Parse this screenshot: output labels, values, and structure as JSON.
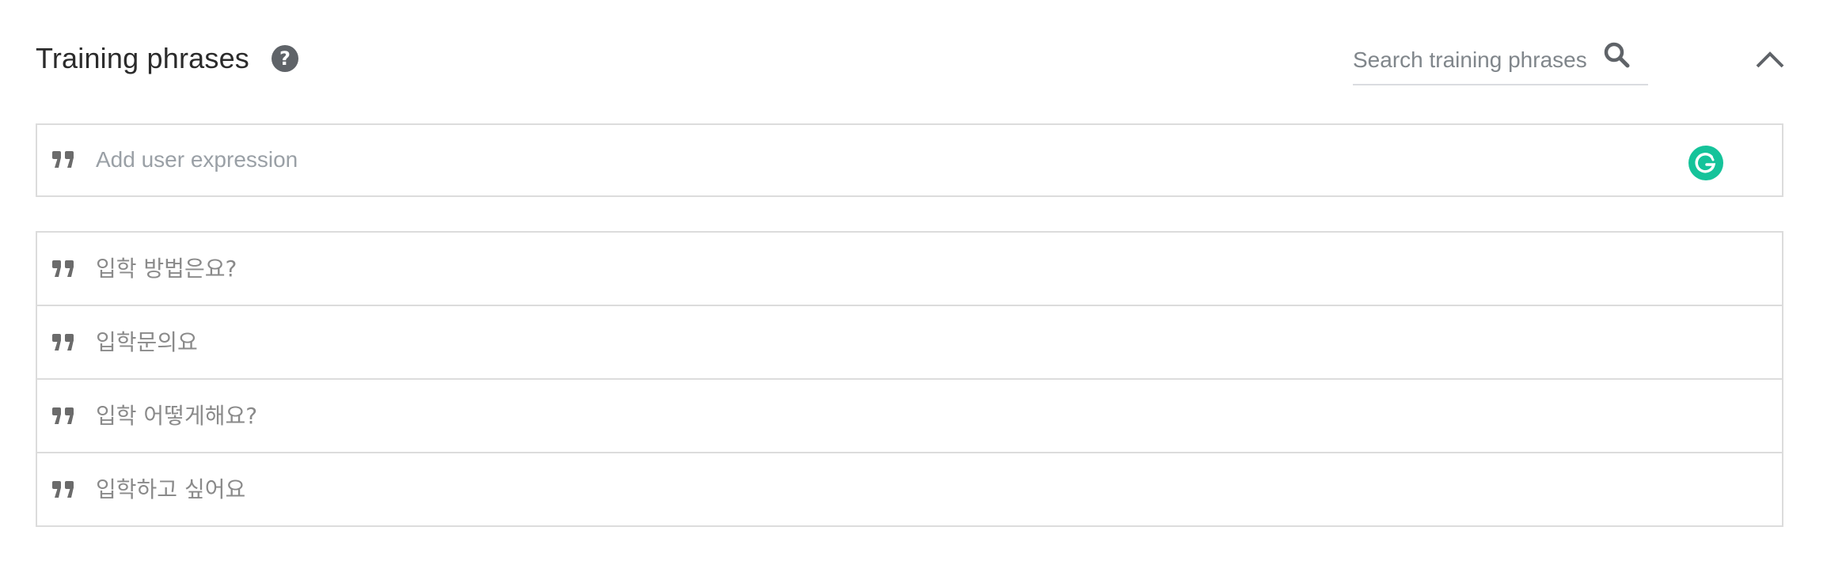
{
  "section": {
    "title": "Training phrases",
    "help_icon": "help-circle-icon",
    "collapse_icon": "chevron-up-icon"
  },
  "search": {
    "placeholder": "Search training phrases",
    "icon": "search-icon"
  },
  "add_expression": {
    "placeholder": "Add user expression",
    "icon": "quote-icon",
    "extension_icon": "grammarly-icon",
    "extension_color": "#15c39a"
  },
  "phrases": [
    {
      "text": "입학 방법은요?"
    },
    {
      "text": "입학문의요"
    },
    {
      "text": "입학 어떻게해요?"
    },
    {
      "text": "입학하고 싶어요"
    }
  ],
  "colors": {
    "border": "#dcdcdc",
    "icon": "#5f6368",
    "phrase_text": "#8a8a8a"
  }
}
